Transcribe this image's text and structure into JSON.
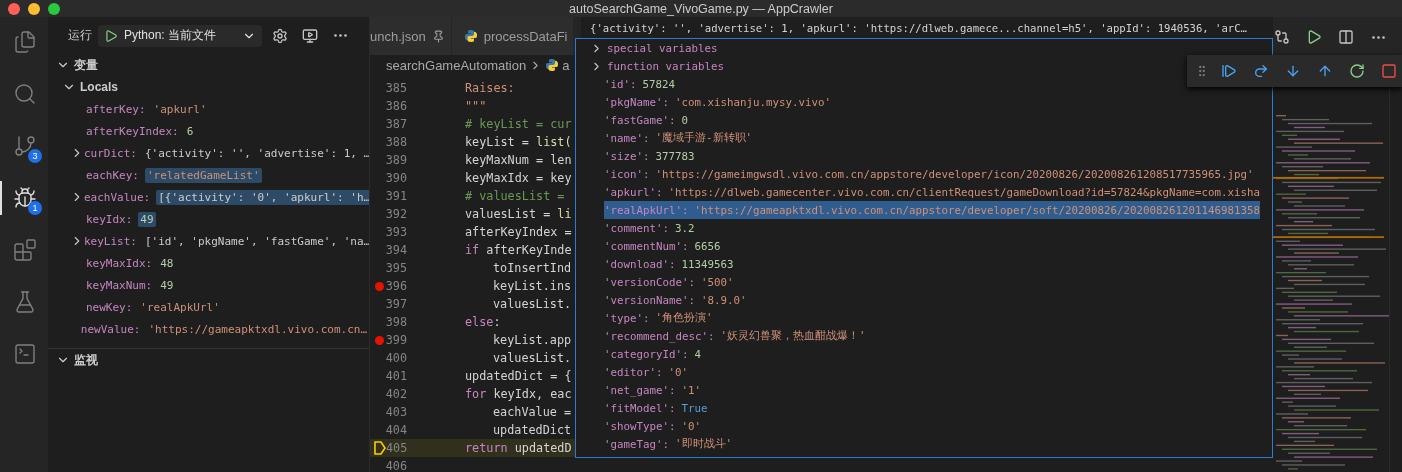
{
  "window": {
    "title": "autoSearchGame_VivoGame.py — AppCrawler"
  },
  "activity_bar": [
    {
      "kind": "files",
      "selected": false
    },
    {
      "kind": "search",
      "selected": false
    },
    {
      "kind": "source-control",
      "selected": false,
      "badge": "3"
    },
    {
      "kind": "debug",
      "selected": true,
      "badge": "1"
    },
    {
      "kind": "extensions",
      "selected": false
    },
    {
      "kind": "testing",
      "selected": false
    },
    {
      "kind": "remote",
      "selected": false
    }
  ],
  "run_toolbar": {
    "label": "运行",
    "config": "Python: 当前文件"
  },
  "variables_section": {
    "title": "变量",
    "expanded": true,
    "scope": {
      "title": "Locals",
      "expanded": true
    },
    "items": [
      {
        "name": "afterKey:",
        "value": "'apkurl'",
        "kind": "string",
        "expandable": false,
        "changed": false
      },
      {
        "name": "afterKeyIndex:",
        "value": "6",
        "kind": "number",
        "expandable": false,
        "changed": false
      },
      {
        "name": "curDict:",
        "value": "{'activity': '', 'advertise': 1, …",
        "kind": "plain",
        "expandable": true,
        "changed": false
      },
      {
        "name": "eachKey:",
        "value": "'relatedGameList'",
        "kind": "string",
        "expandable": false,
        "changed": true
      },
      {
        "name": "eachValue:",
        "value": "[{'activity': '0', 'apkurl': 'h…",
        "kind": "plain",
        "expandable": true,
        "changed": true
      },
      {
        "name": "keyIdx:",
        "value": "49",
        "kind": "number",
        "expandable": false,
        "changed": true
      },
      {
        "name": "keyList:",
        "value": "['id', 'pkgName', 'fastGame', 'na…",
        "kind": "plain",
        "expandable": true,
        "changed": false
      },
      {
        "name": "keyMaxIdx:",
        "value": "48",
        "kind": "number",
        "expandable": false,
        "changed": false
      },
      {
        "name": "keyMaxNum:",
        "value": "49",
        "kind": "number",
        "expandable": false,
        "changed": false
      },
      {
        "name": "newKey:",
        "value": "'realApkUrl'",
        "kind": "string",
        "expandable": false,
        "changed": false
      },
      {
        "name": "newValue:",
        "value": "'https://gameapktxdl.vivo.com.cn…",
        "kind": "string",
        "expandable": false,
        "changed": false
      }
    ]
  },
  "watch_section": {
    "title": "监视",
    "expanded": true
  },
  "tabs": [
    {
      "label": "unch.json",
      "selected": false
    },
    {
      "label": "processDataFi",
      "selected": false
    }
  ],
  "breadcrumb": [
    "searchGameAutomation",
    "a"
  ],
  "code_lines": [
    {
      "number": "385",
      "tokens": [
        {
          "text": "Raises:",
          "kind": "string"
        }
      ]
    },
    {
      "number": "386",
      "tokens": [
        {
          "text": "\"\"\"",
          "kind": "string"
        }
      ]
    },
    {
      "number": "387",
      "tokens": [
        {
          "text": "# keyList = cur",
          "kind": "comment"
        }
      ]
    },
    {
      "number": "388",
      "tokens": [
        {
          "text": "keyList = "
        },
        {
          "text": "list(",
          "kind": "function"
        }
      ]
    },
    {
      "number": "389",
      "tokens": [
        {
          "text": "keyMaxNum = len"
        }
      ]
    },
    {
      "number": "390",
      "tokens": [
        {
          "text": "keyMaxIdx = key"
        }
      ]
    },
    {
      "number": "391",
      "tokens": [
        {
          "text": "# valuesList =",
          "kind": "comment"
        }
      ]
    },
    {
      "number": "392",
      "tokens": [
        {
          "text": "valuesList = "
        },
        {
          "text": "li",
          "kind": "function"
        }
      ]
    },
    {
      "number": "393",
      "tokens": [
        {
          "text": "afterKeyIndex ="
        }
      ]
    },
    {
      "number": "394",
      "tokens": [
        {
          "text": "if",
          "kind": "keyword"
        },
        {
          "text": " afterKeyInde"
        }
      ],
      "children": [
        {
          "number": "395",
          "tokens": [
            {
              "text": "toInsertInd"
            }
          ]
        },
        {
          "number": "396",
          "breakpoint": true,
          "tokens": [
            {
              "text": "keyList.ins"
            }
          ]
        },
        {
          "number": "397",
          "tokens": [
            {
              "text": "valuesList."
            }
          ]
        }
      ]
    },
    {
      "number": "398",
      "tokens": [
        {
          "text": "else",
          "kind": "keyword"
        },
        {
          "text": ":"
        }
      ],
      "children": [
        {
          "number": "399",
          "breakpoint": true,
          "tokens": [
            {
              "text": "keyList.app"
            }
          ]
        },
        {
          "number": "400",
          "tokens": [
            {
              "text": "valuesList."
            }
          ]
        }
      ]
    },
    {
      "number": "401",
      "tokens": [
        {
          "text": "updatedDict = {"
        }
      ]
    },
    {
      "number": "402",
      "tokens": [
        {
          "text": "for",
          "kind": "keyword"
        },
        {
          "text": " keyIdx, eac"
        }
      ],
      "children": [
        {
          "number": "403",
          "tokens": [
            {
              "text": "eachValue ="
            }
          ]
        },
        {
          "number": "404",
          "tokens": [
            {
              "text": "updatedDict"
            }
          ]
        }
      ]
    },
    {
      "number": "405",
      "current": true,
      "tokens": [
        {
          "text": "return",
          "kind": "keyword"
        },
        {
          "text": " updatedD"
        }
      ]
    },
    {
      "number": "406"
    }
  ],
  "hover": {
    "header": "{'activity': '', 'advertise': 1, 'apkurl': 'https://dlweb.gamece...channel=h5', 'appId': 1940536, 'arC…",
    "groups": [
      {
        "label": "special variables",
        "expanded": false
      },
      {
        "label": "function variables",
        "expanded": false
      }
    ],
    "entries": [
      {
        "key": "'id':",
        "value": "57824",
        "kind": "number",
        "selected": false
      },
      {
        "key": "'pkgName':",
        "value": "'com.xishanju.mysy.vivo'",
        "kind": "string",
        "selected": false
      },
      {
        "key": "'fastGame':",
        "value": "0",
        "kind": "number",
        "selected": false
      },
      {
        "key": "'name':",
        "value": "'魔域手游-新转职'",
        "kind": "string",
        "selected": false
      },
      {
        "key": "'size':",
        "value": "377783",
        "kind": "number",
        "selected": false
      },
      {
        "key": "'icon':",
        "value": "'https://gameimgwsdl.vivo.com.cn/appstore/developer/icon/20200826/202008261208517735965.jpg'",
        "kind": "string",
        "selected": false
      },
      {
        "key": "'apkurl':",
        "value": "'https://dlweb.gamecenter.vivo.com.cn/clientRequest/gameDownload?id=57824&pkgName=com.xisha",
        "kind": "string",
        "selected": false
      },
      {
        "key": "'realApkUrl':",
        "value": "'https://gameapktxdl.vivo.com.cn/appstore/developer/soft/20200826/202008261201146981358",
        "kind": "string",
        "selected": true
      },
      {
        "key": "'comment':",
        "value": "3.2",
        "kind": "number",
        "selected": false
      },
      {
        "key": "'commentNum':",
        "value": "6656",
        "kind": "number",
        "selected": false
      },
      {
        "key": "'download':",
        "value": "11349563",
        "kind": "number",
        "selected": false
      },
      {
        "key": "'versionCode':",
        "value": "'500'",
        "kind": "string",
        "selected": false
      },
      {
        "key": "'versionName':",
        "value": "'8.9.0'",
        "kind": "string",
        "selected": false
      },
      {
        "key": "'type':",
        "value": "'角色扮演'",
        "kind": "string",
        "selected": false
      },
      {
        "key": "'recommend_desc':",
        "value": "'妖灵幻兽聚，热血酣战爆！'",
        "kind": "string",
        "selected": false
      },
      {
        "key": "'categoryId':",
        "value": "4",
        "kind": "number",
        "selected": false
      },
      {
        "key": "'editor':",
        "value": "'0'",
        "kind": "string",
        "selected": false
      },
      {
        "key": "'net_game':",
        "value": "'1'",
        "kind": "string",
        "selected": false
      },
      {
        "key": "'fitModel':",
        "value": "True",
        "kind": "bool",
        "selected": false
      },
      {
        "key": "'showType':",
        "value": "'0'",
        "kind": "string",
        "selected": false
      },
      {
        "key": "'gameTag':",
        "value": "'即时战斗'",
        "kind": "string",
        "selected": false
      }
    ]
  },
  "debug_toolbar": [
    {
      "kind": "continue"
    },
    {
      "kind": "step-over"
    },
    {
      "kind": "step-into"
    },
    {
      "kind": "step-out"
    },
    {
      "kind": "restart"
    },
    {
      "kind": "stop"
    }
  ]
}
